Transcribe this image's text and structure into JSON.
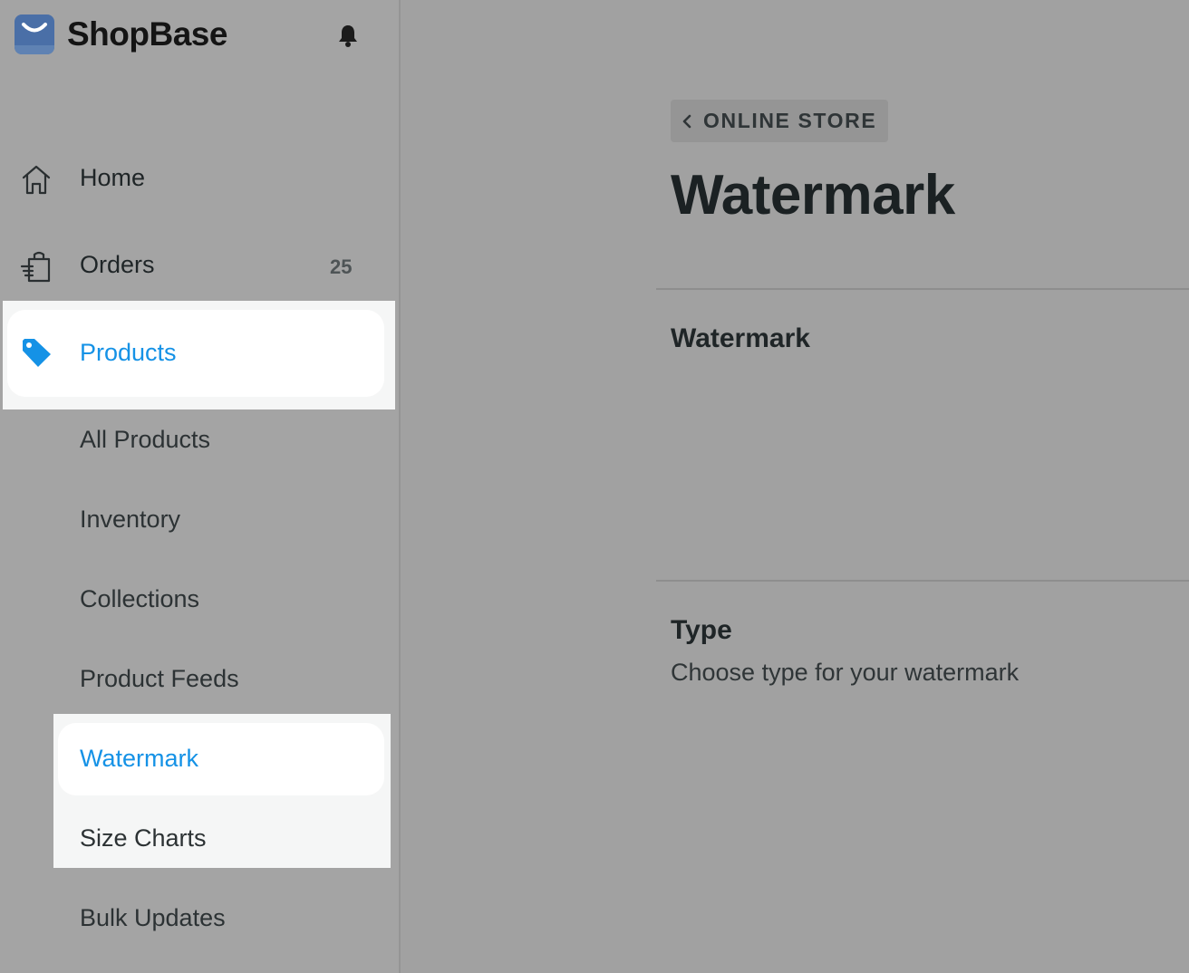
{
  "app": {
    "brand": "ShopBase",
    "accent_color": "#1592e6",
    "logo_icon": "shopbase-bag-icon",
    "bell_icon": "bell-icon"
  },
  "sidebar": {
    "items": [
      {
        "label": "Home",
        "icon": "home-icon"
      },
      {
        "label": "Orders",
        "icon": "orders-icon",
        "badge": "25"
      },
      {
        "label": "Products",
        "icon": "tag-icon",
        "active": true
      }
    ],
    "sub_items": [
      {
        "label": "All Products"
      },
      {
        "label": "Inventory"
      },
      {
        "label": "Collections"
      },
      {
        "label": "Product Feeds"
      },
      {
        "label": "Watermark",
        "active": true
      },
      {
        "label": "Size Charts"
      },
      {
        "label": "Bulk Updates"
      }
    ]
  },
  "main": {
    "breadcrumb": "ONLINE STORE",
    "title": "Watermark",
    "sections": [
      {
        "title": "Watermark",
        "description": ""
      },
      {
        "title": "Type",
        "description": "Choose type for your watermark"
      }
    ]
  }
}
